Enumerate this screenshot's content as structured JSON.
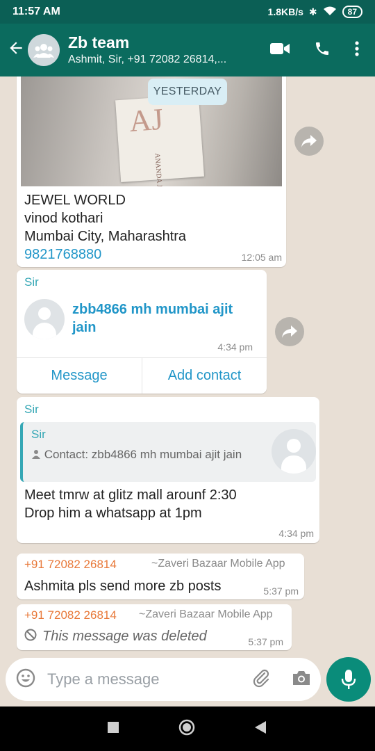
{
  "status": {
    "time": "11:57 AM",
    "speed": "1.8KB/s",
    "battery": "87"
  },
  "header": {
    "title": "Zb team",
    "subtitle": "Ashmit, Sir, +91 72082 26814,..."
  },
  "date_pill": "YESTERDAY",
  "messages": [
    {
      "type": "image_caption",
      "lines": [
        "JEWEL WORLD",
        "vinod kothari",
        "Mumbai City, Maharashtra"
      ],
      "phone": "9821768880",
      "time": "12:05 am",
      "image_text": {
        "mono": "AJ",
        "brand": "ANANDA J"
      }
    },
    {
      "type": "contact",
      "sender": "Sir",
      "contact_name": "zbb4866 mh mumbai ajit jain",
      "time": "4:34 pm",
      "actions": [
        "Message",
        "Add contact"
      ]
    },
    {
      "type": "reply",
      "sender": "Sir",
      "quote": {
        "sender": "Sir",
        "text": "Contact: zbb4866 mh mumbai ajit jain"
      },
      "line1": "Meet tmrw at glitz mall arounf 2:30",
      "line2": "Drop him a whatsapp at 1pm",
      "time": "4:34 pm"
    },
    {
      "type": "text",
      "sender": "+91 72082 26814",
      "note": "~Zaveri Bazaar Mobile App",
      "text": "Ashmita pls send more zb posts",
      "time": "5:37 pm"
    },
    {
      "type": "deleted",
      "sender": "+91 72082 26814",
      "note": "~Zaveri Bazaar Mobile App",
      "text": "This message was deleted",
      "time": "5:37 pm"
    }
  ],
  "composer": {
    "placeholder": "Type a message"
  },
  "icons": [
    "back-arrow-icon",
    "group-avatar-icon",
    "video-call-icon",
    "phone-icon",
    "more-vert-icon",
    "forward-icon",
    "emoji-icon",
    "attach-icon",
    "camera-icon",
    "mic-icon",
    "nav-back-icon",
    "nav-home-icon",
    "nav-recents-icon",
    "blocked-icon",
    "person-icon"
  ],
  "colors": {
    "header": "#0b6b5e",
    "accent_teal": "#35a7b5",
    "sender_orange": "#e8793a",
    "link_blue": "#2196c8",
    "mic_green": "#0a8c7a"
  }
}
